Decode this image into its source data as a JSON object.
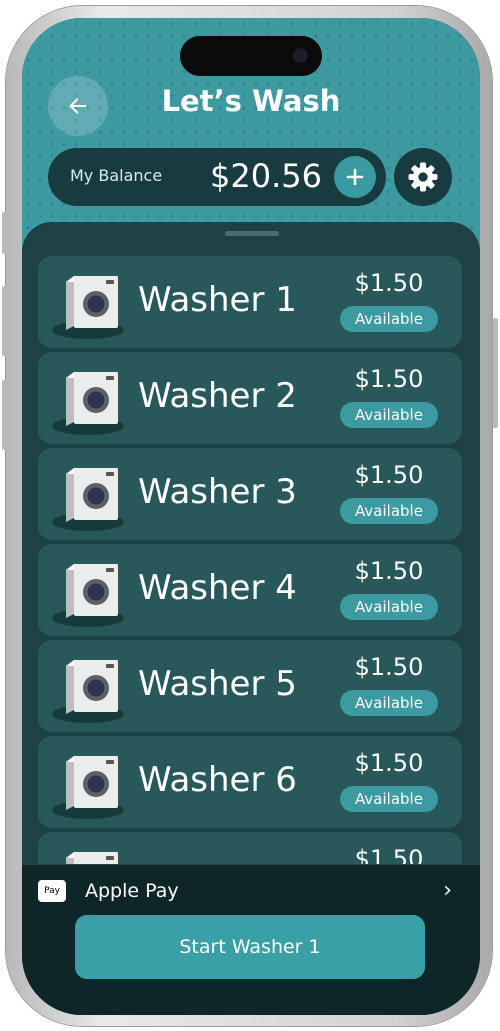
{
  "header": {
    "title": "Let’s Wash",
    "back_icon": "arrow-left-icon"
  },
  "balance": {
    "label": "My Balance",
    "amount": "$20.56",
    "add_icon": "plus-icon",
    "settings_icon": "gear-icon"
  },
  "washers": [
    {
      "name": "Washer 1",
      "price": "$1.50",
      "status": "Available"
    },
    {
      "name": "Washer 2",
      "price": "$1.50",
      "status": "Available"
    },
    {
      "name": "Washer 3",
      "price": "$1.50",
      "status": "Available"
    },
    {
      "name": "Washer 4",
      "price": "$1.50",
      "status": "Available"
    },
    {
      "name": "Washer 5",
      "price": "$1.50",
      "status": "Available"
    },
    {
      "name": "Washer 6",
      "price": "$1.50",
      "status": "Available"
    },
    {
      "name": "",
      "price": "$1.50",
      "status": ""
    }
  ],
  "payment": {
    "method_logo": "Pay",
    "method_label": "Apple Pay",
    "chevron": "›"
  },
  "action": {
    "start_label": "Start Washer 1"
  },
  "colors": {
    "accent": "#3aa0a8",
    "header_bg": "#3e9aa1",
    "panel_bg": "#1e4244",
    "card_bg": "#29585a",
    "footer_bg": "#0f2628"
  }
}
